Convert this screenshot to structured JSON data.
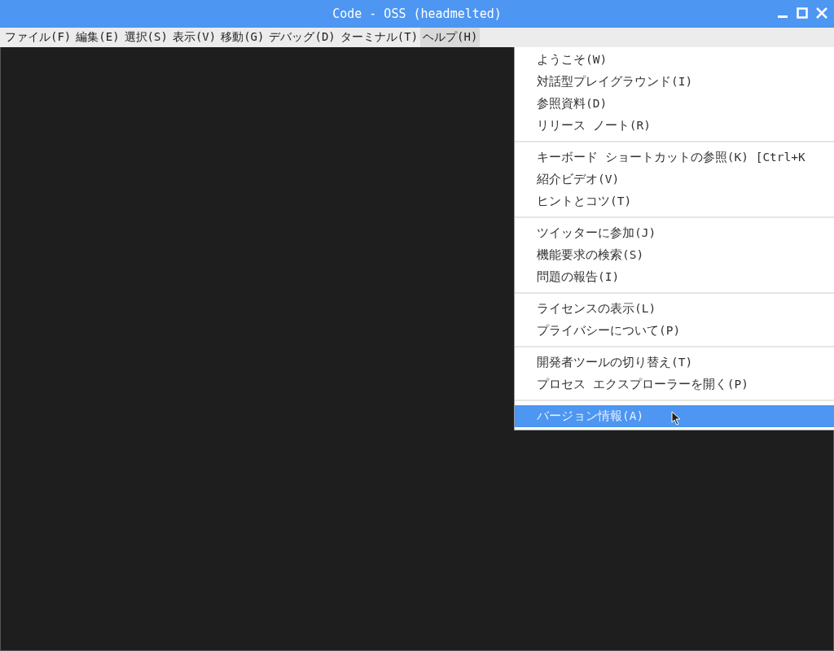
{
  "window": {
    "title": "Code - OSS (headmelted)"
  },
  "menu_bar": [
    {
      "label": "ファイル(F)",
      "selected": false
    },
    {
      "label": "編集(E)",
      "selected": false
    },
    {
      "label": "選択(S)",
      "selected": false
    },
    {
      "label": "表示(V)",
      "selected": false
    },
    {
      "label": "移動(G)",
      "selected": false
    },
    {
      "label": "デバッグ(D)",
      "selected": false
    },
    {
      "label": "ターミナル(T)",
      "selected": false
    },
    {
      "label": "ヘルプ(H)",
      "selected": true
    }
  ],
  "help_menu": [
    [
      {
        "label": "ようこそ(W)",
        "selected": false
      },
      {
        "label": "対話型プレイグラウンド(I)",
        "selected": false
      },
      {
        "label": "参照資料(D)",
        "selected": false
      },
      {
        "label": "リリース ノート(R)",
        "selected": false
      }
    ],
    [
      {
        "label": "キーボード ショートカットの参照(K) [Ctrl+K",
        "selected": false
      },
      {
        "label": "紹介ビデオ(V)",
        "selected": false
      },
      {
        "label": "ヒントとコツ(T)",
        "selected": false
      }
    ],
    [
      {
        "label": "ツイッターに参加(J)",
        "selected": false
      },
      {
        "label": "機能要求の検索(S)",
        "selected": false
      },
      {
        "label": "問題の報告(I)",
        "selected": false
      }
    ],
    [
      {
        "label": "ライセンスの表示(L)",
        "selected": false
      },
      {
        "label": "プライバシーについて(P)",
        "selected": false
      }
    ],
    [
      {
        "label": "開発者ツールの切り替え(T)",
        "selected": false
      },
      {
        "label": "プロセス エクスプローラーを開く(P)",
        "selected": false
      }
    ],
    [
      {
        "label": "バージョン情報(A)",
        "selected": true
      }
    ]
  ]
}
